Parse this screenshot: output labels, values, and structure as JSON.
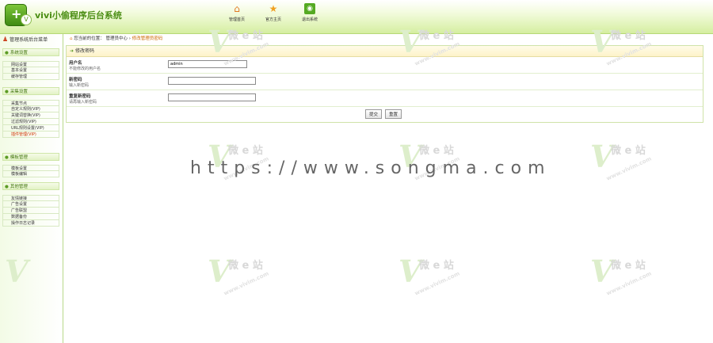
{
  "header": {
    "logo_glyph": "+",
    "logo_badge": "V",
    "title": "vivi小偷程序后台系统",
    "nav": [
      {
        "icon": "home-icon",
        "glyph": "⌂",
        "label": "管理首页"
      },
      {
        "icon": "star-icon",
        "glyph": "★",
        "label": "官方主页"
      },
      {
        "icon": "rss-icon",
        "glyph": "◉",
        "label": "退出系统"
      }
    ]
  },
  "sidebar": {
    "header": "管理系统后台菜单",
    "groups": [
      {
        "title": "系统设置",
        "items": [
          {
            "label": "网站设置",
            "active": false
          },
          {
            "label": "基本设置",
            "active": false
          },
          {
            "label": "缓存管理",
            "active": false
          }
        ]
      },
      {
        "title": "采集设置",
        "items": [
          {
            "label": "采集节点",
            "active": false
          },
          {
            "label": "自定义规则(VIP)",
            "active": false
          },
          {
            "label": "关键词替换(VIP)",
            "active": false
          },
          {
            "label": "过滤规则(VIP)",
            "active": false
          },
          {
            "label": "URL规则设置(VIP)",
            "active": false
          },
          {
            "label": "插件管理(VIP)",
            "active": true
          }
        ]
      },
      {
        "title": "模板管理",
        "items": [
          {
            "label": "模板设置",
            "active": false
          },
          {
            "label": "模板编辑",
            "active": false
          }
        ]
      },
      {
        "title": "其他管理",
        "items": [
          {
            "label": "友情链接",
            "active": false
          },
          {
            "label": "广告设置",
            "active": false
          },
          {
            "label": "广告联盟",
            "active": false
          },
          {
            "label": "数据备份",
            "active": false
          },
          {
            "label": "操作日志记录",
            "active": false
          }
        ]
      }
    ]
  },
  "breadcrumb": {
    "prefix": "您当前的位置：",
    "section": "管理员中心",
    "current": "修改管理员密码"
  },
  "panel": {
    "title": "修改密码",
    "fields": [
      {
        "label": "用户名",
        "hint": "不能修改的用户名",
        "value": "admin",
        "width": 100
      },
      {
        "label": "新密码",
        "hint": "输入新密码",
        "value": "",
        "width": 111
      },
      {
        "label": "重复新密码",
        "hint": "请再输入新密码",
        "value": "",
        "width": 111
      }
    ],
    "submit_label": "提交",
    "reset_label": "重置"
  },
  "watermark": {
    "glyph": "V",
    "text": "微 e 站",
    "url": "www.vivim.com"
  },
  "overlay_url": "https://www.songma.com"
}
